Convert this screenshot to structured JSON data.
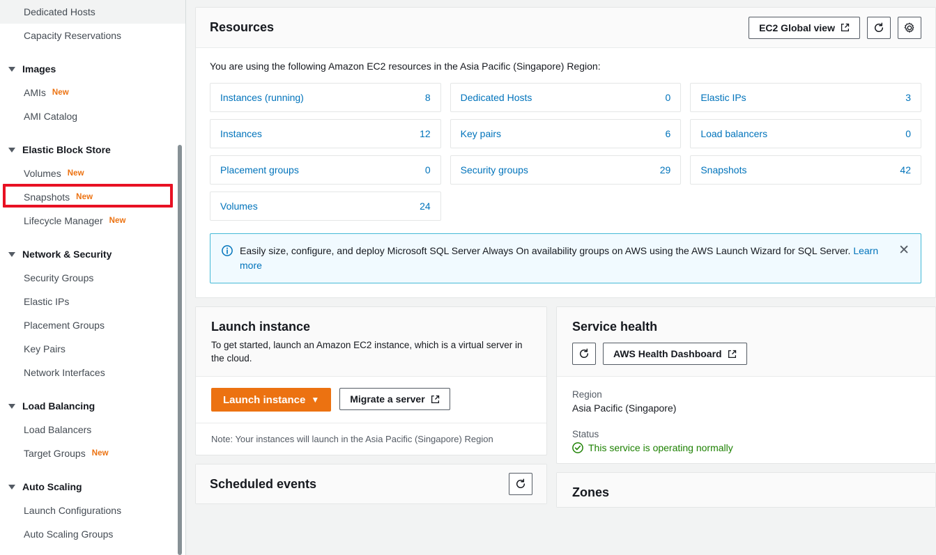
{
  "sidebar": {
    "items": [
      {
        "type": "link",
        "label": "Dedicated Hosts",
        "badge": ""
      },
      {
        "type": "link",
        "label": "Capacity Reservations",
        "badge": ""
      },
      {
        "type": "group",
        "label": "Images"
      },
      {
        "type": "link",
        "label": "AMIs",
        "badge": "New"
      },
      {
        "type": "link",
        "label": "AMI Catalog",
        "badge": ""
      },
      {
        "type": "group",
        "label": "Elastic Block Store"
      },
      {
        "type": "link",
        "label": "Volumes",
        "badge": "New"
      },
      {
        "type": "link",
        "label": "Snapshots",
        "badge": "New",
        "highlighted": true
      },
      {
        "type": "link",
        "label": "Lifecycle Manager",
        "badge": "New"
      },
      {
        "type": "group",
        "label": "Network & Security"
      },
      {
        "type": "link",
        "label": "Security Groups",
        "badge": ""
      },
      {
        "type": "link",
        "label": "Elastic IPs",
        "badge": ""
      },
      {
        "type": "link",
        "label": "Placement Groups",
        "badge": ""
      },
      {
        "type": "link",
        "label": "Key Pairs",
        "badge": ""
      },
      {
        "type": "link",
        "label": "Network Interfaces",
        "badge": ""
      },
      {
        "type": "group",
        "label": "Load Balancing"
      },
      {
        "type": "link",
        "label": "Load Balancers",
        "badge": ""
      },
      {
        "type": "link",
        "label": "Target Groups",
        "badge": "New"
      },
      {
        "type": "group",
        "label": "Auto Scaling"
      },
      {
        "type": "link",
        "label": "Launch Configurations",
        "badge": ""
      },
      {
        "type": "link",
        "label": "Auto Scaling Groups",
        "badge": ""
      }
    ],
    "highlight_color": "#e81123",
    "badge_color": "#ec7211"
  },
  "resources": {
    "title": "Resources",
    "global_view_label": "EC2 Global view",
    "refresh_label": "",
    "settings_label": "",
    "intro": "You are using the following Amazon EC2 resources in the Asia Pacific (Singapore) Region:",
    "tiles": [
      {
        "label": "Instances (running)",
        "count": "8"
      },
      {
        "label": "Dedicated Hosts",
        "count": "0"
      },
      {
        "label": "Elastic IPs",
        "count": "3"
      },
      {
        "label": "Instances",
        "count": "12"
      },
      {
        "label": "Key pairs",
        "count": "6"
      },
      {
        "label": "Load balancers",
        "count": "0"
      },
      {
        "label": "Placement groups",
        "count": "0"
      },
      {
        "label": "Security groups",
        "count": "29"
      },
      {
        "label": "Snapshots",
        "count": "42"
      },
      {
        "label": "Volumes",
        "count": "24"
      }
    ],
    "link_color": "#0073bb"
  },
  "banner": {
    "text": "Easily size, configure, and deploy Microsoft SQL Server Always On availability groups on AWS using the AWS Launch Wizard for SQL Server.",
    "link_label": "Learn more",
    "close_label": "✕",
    "background": "#f1faff",
    "border": "#44b9d6"
  },
  "launch_instance": {
    "title": "Launch instance",
    "description": "To get started, launch an Amazon EC2 instance, which is a virtual server in the cloud.",
    "primary_label": "Launch instance",
    "primary_caret": "▼",
    "secondary_label": "Migrate a server",
    "note": "Note: Your instances will launch in the Asia Pacific (Singapore) Region",
    "primary_color": "#ec7211"
  },
  "service_health": {
    "title": "Service health",
    "dashboard_label": "AWS Health Dashboard",
    "region_label": "Region",
    "region_value": "Asia Pacific (Singapore)",
    "status_label": "Status",
    "status_value": "This service is operating normally",
    "status_color": "#1d8102"
  },
  "scheduled_events": {
    "title": "Scheduled events"
  },
  "zones": {
    "title": "Zones"
  }
}
